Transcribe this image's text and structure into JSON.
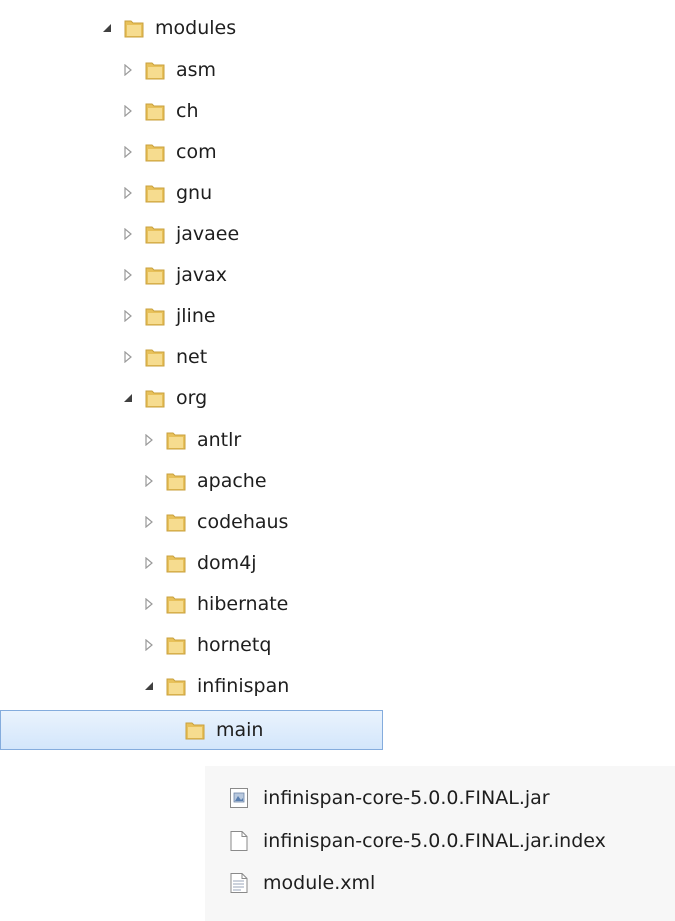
{
  "tree": {
    "root": {
      "label": "modules",
      "icon": "folder-icon"
    },
    "level1": [
      {
        "label": "asm",
        "expanded": false
      },
      {
        "label": "ch",
        "expanded": false
      },
      {
        "label": "com",
        "expanded": false
      },
      {
        "label": "gnu",
        "expanded": false
      },
      {
        "label": "javaee",
        "expanded": false
      },
      {
        "label": "javax",
        "expanded": false
      },
      {
        "label": "jline",
        "expanded": false
      },
      {
        "label": "net",
        "expanded": false
      },
      {
        "label": "org",
        "expanded": true
      }
    ],
    "org_children": [
      {
        "label": "antlr",
        "expanded": false
      },
      {
        "label": "apache",
        "expanded": false
      },
      {
        "label": "codehaus",
        "expanded": false
      },
      {
        "label": "dom4j",
        "expanded": false
      },
      {
        "label": "hibernate",
        "expanded": false
      },
      {
        "label": "hornetq",
        "expanded": false
      },
      {
        "label": "infinispan",
        "expanded": true
      }
    ],
    "infinispan_children": [
      {
        "label": "main",
        "selected": true
      }
    ]
  },
  "files": [
    {
      "name": "infinispan-core-5.0.0.FINAL.jar",
      "icon": "jar-file-icon"
    },
    {
      "name": "infinispan-core-5.0.0.FINAL.jar.index",
      "icon": "blank-file-icon"
    },
    {
      "name": "module.xml",
      "icon": "text-file-icon"
    }
  ],
  "colors": {
    "selection_border": "#84acdd",
    "folder": "#e8c15a",
    "expander": "#9a9a9a",
    "expanded_arrow": "#404040"
  }
}
